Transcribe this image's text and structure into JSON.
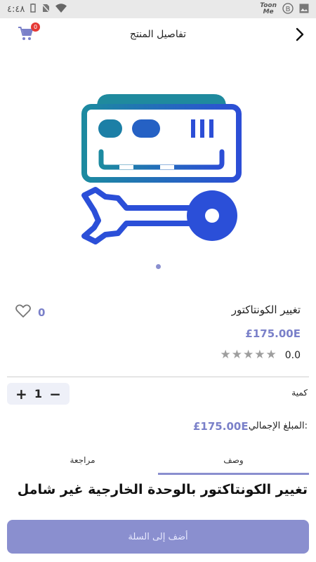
{
  "status_bar": {
    "time": "٤:٤٨",
    "brand_line1": "Toon",
    "brand_line2": "Me"
  },
  "header": {
    "title": "تفاصيل المنتج",
    "cart_count": "0"
  },
  "product": {
    "name": "تغيير الكونتاكتور",
    "price": "£175.00E",
    "likes": "0",
    "rating": "0.0",
    "rating_stars": 5,
    "rating_filled": 0
  },
  "quantity": {
    "label": "كمية",
    "value": "1",
    "plus": "+",
    "minus": "−"
  },
  "total": {
    "label": "المبلغ الإجمالي:",
    "value": "£175.00E"
  },
  "tabs": [
    {
      "label": "وصف",
      "active": true
    },
    {
      "label": "مراجعة",
      "active": false
    }
  ],
  "description": "تغيير الكونتاكتور بالوحدة الخارجية غير شامل",
  "add_to_cart": "أضف إلى السلة",
  "colors": {
    "accent": "#8a8fcf",
    "price": "#7a80c9",
    "badge": "#e53935",
    "icon_teal": "#1f8a9e",
    "icon_blue": "#2b4fd8"
  }
}
